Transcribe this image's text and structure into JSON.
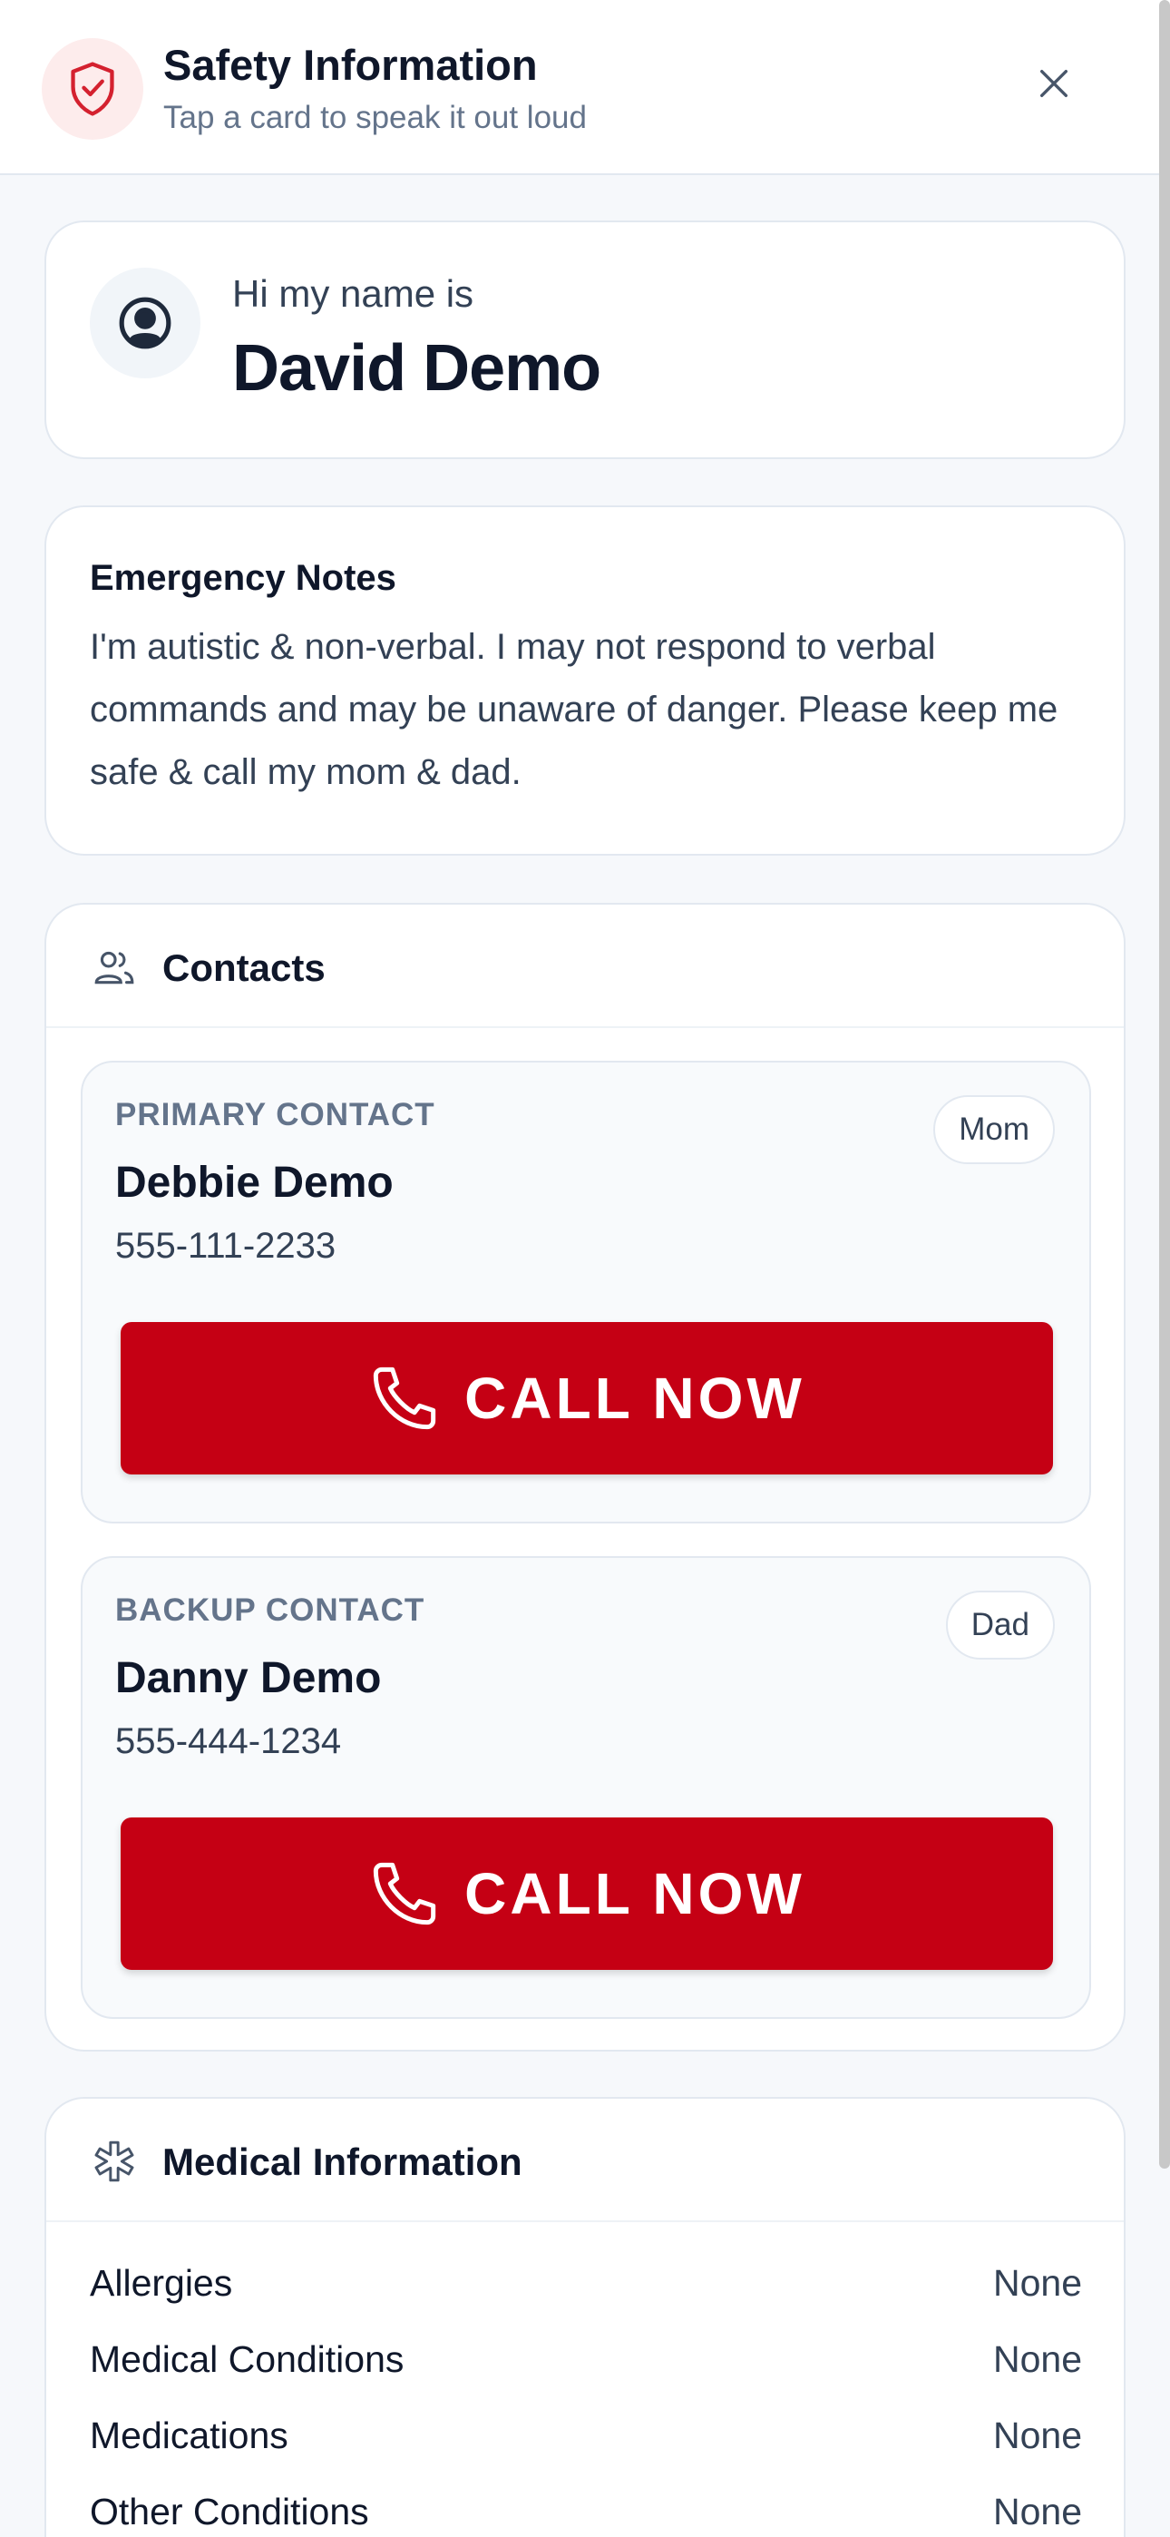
{
  "header": {
    "title": "Safety Information",
    "subtitle": "Tap a card to speak it out loud",
    "icon": "shield-check-icon",
    "close_icon": "close-icon"
  },
  "identity": {
    "greeting": "Hi my name is",
    "name": "David Demo",
    "icon": "user-circle-icon"
  },
  "notes": {
    "title": "Emergency Notes",
    "body": "I'm autistic & non-verbal. I may not respond to verbal commands and may be unaware of danger. Please keep me safe & call my mom & dad."
  },
  "contacts": {
    "title": "Contacts",
    "icon": "users-icon",
    "primary": {
      "label": "PRIMARY CONTACT",
      "name": "Debbie Demo",
      "phone": "555-111-2233",
      "relation": "Mom",
      "call_label": "CALL NOW"
    },
    "backup": {
      "label": "BACKUP CONTACT",
      "name": "Danny Demo",
      "phone": "555-444-1234",
      "relation": "Dad",
      "call_label": "CALL NOW"
    }
  },
  "medical": {
    "title": "Medical Information",
    "icon": "medical-asterisk-icon",
    "rows": [
      {
        "label": "Allergies",
        "value": "None"
      },
      {
        "label": "Medical Conditions",
        "value": "None"
      },
      {
        "label": "Medications",
        "value": "None"
      },
      {
        "label": "Other Conditions",
        "value": "None"
      }
    ]
  },
  "colors": {
    "accent_red": "#c50014",
    "shield_bg": "#fdecec",
    "page_bg": "#f6f8fb"
  }
}
